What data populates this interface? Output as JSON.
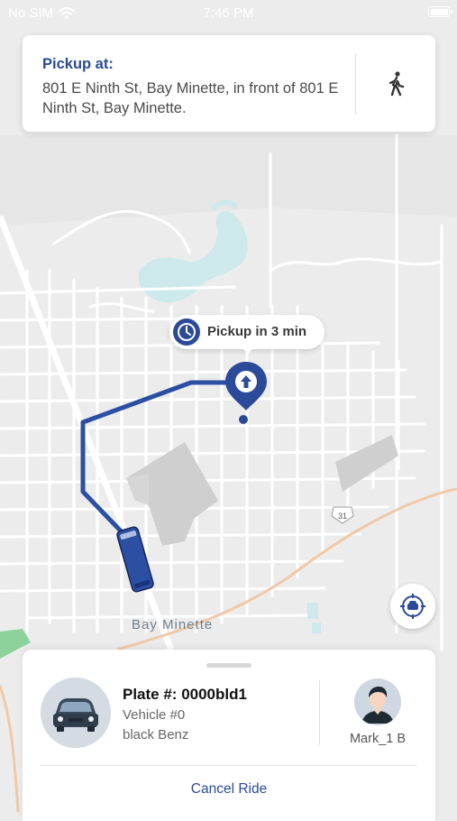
{
  "status_bar": {
    "carrier": "No SIM",
    "time": "7:46 PM"
  },
  "pickup": {
    "label": "Pickup at:",
    "address": "801 E Ninth St, Bay Minette, in front of 801 E Ninth St, Bay Minette."
  },
  "map": {
    "eta": "Pickup in 3 min",
    "city_label": "Bay Minette",
    "route_shield": "31"
  },
  "ride": {
    "plate": "Plate #: 0000bld1",
    "vehicle_number": "Vehicle #0",
    "vehicle_description": "black Benz",
    "driver_name": "Mark_1 B",
    "cancel_label": "Cancel Ride"
  },
  "colors": {
    "accent": "#2b4a9a",
    "route": "#2b4fa3",
    "map_background": "#ececec"
  },
  "icons": [
    "wifi-icon",
    "battery-icon",
    "walking-icon",
    "clock-icon",
    "pickup-pin-icon",
    "recenter-icon",
    "car-icon",
    "driver-avatar-icon"
  ]
}
